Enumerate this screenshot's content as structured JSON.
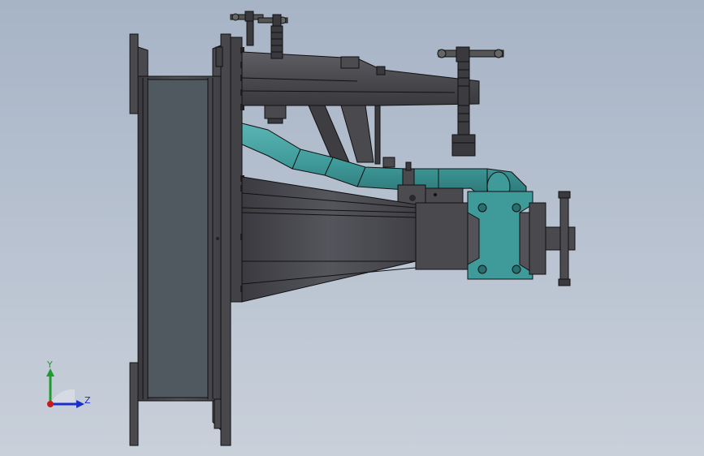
{
  "viewport": {
    "background_top": "#a7b4c6",
    "background_bottom": "#c9d0da"
  },
  "model": {
    "steel_color": "#4a4a4e",
    "steel_light": "#5c5c62",
    "steel_dark": "#2f2f33",
    "pipe_color": "#3f9a9a",
    "pipe_dark": "#2a6f70",
    "outline_color": "#111111"
  },
  "triad": {
    "y_label": "Y",
    "z_label": "Z",
    "y_color": "#1f9a2f",
    "z_color": "#1a2fc8",
    "x_color": "#c81a1a"
  }
}
